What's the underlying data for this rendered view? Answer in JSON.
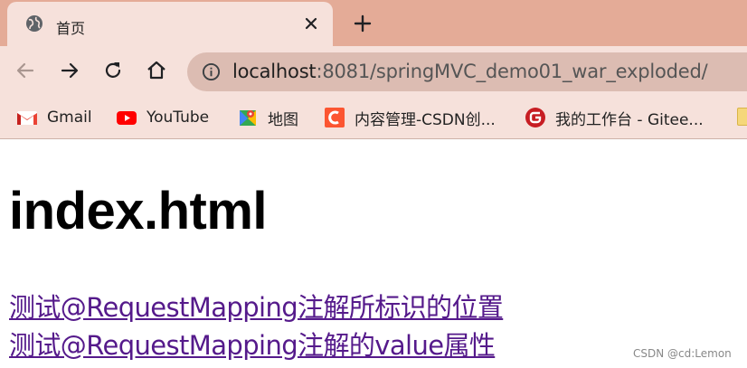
{
  "tab": {
    "title": "首页",
    "favicon": "globe-icon"
  },
  "toolbar": {
    "url_host": "localhost",
    "url_rest": ":8081/springMVC_demo01_war_exploded/"
  },
  "bookmarks": [
    {
      "label": "Gmail",
      "icon": "gmail-icon"
    },
    {
      "label": "YouTube",
      "icon": "youtube-icon"
    },
    {
      "label": "地图",
      "icon": "maps-icon"
    },
    {
      "label": "内容管理-CSDN创...",
      "icon": "csdn-icon"
    },
    {
      "label": "我的工作台 - Gitee...",
      "icon": "gitee-icon"
    }
  ],
  "page": {
    "heading": "index.html",
    "links": [
      "测试@RequestMapping注解所标识的位置",
      "测试@RequestMapping注解的value属性"
    ],
    "watermark": "CSDN @cd:Lemon"
  },
  "colors": {
    "tabstrip": "#e4ab97",
    "toolbar": "#f6e1db",
    "omnibox": "#dcbcb2",
    "visited_link": "#551a8b"
  }
}
